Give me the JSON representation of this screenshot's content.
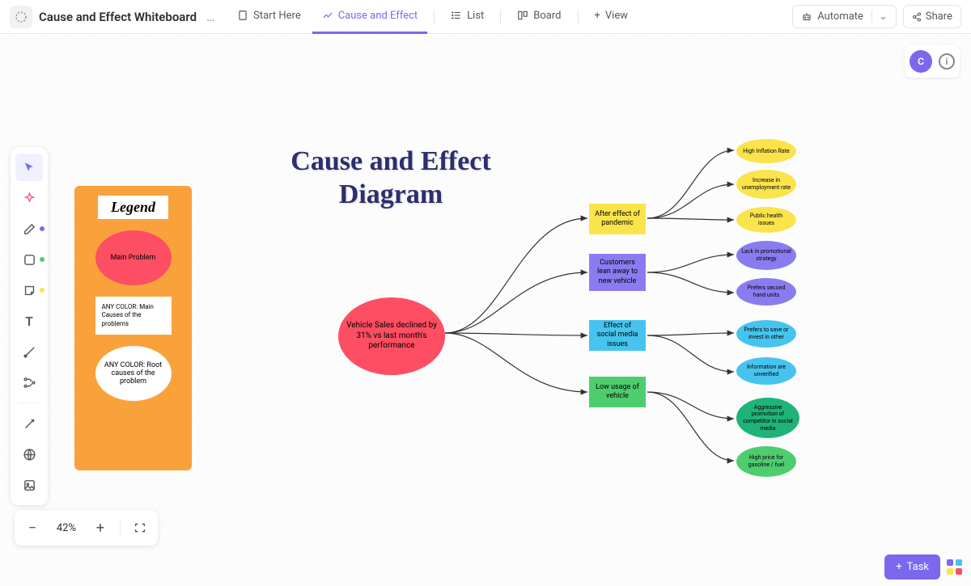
{
  "header": {
    "title": "Cause and Effect Whiteboard",
    "tabs": {
      "start": "Start Here",
      "cause": "Cause and Effect",
      "list": "List",
      "board": "Board",
      "view": "View"
    },
    "automate": "Automate",
    "share": "Share",
    "avatar": "C"
  },
  "zoom": {
    "value": "42%"
  },
  "task_btn": "Task",
  "diagram": {
    "title": "Cause and Effect Diagram",
    "legend": {
      "title": "Legend",
      "main_problem": "Main Problem",
      "main_causes": "ANY COLOR: Main Causes of the problems",
      "root_causes": "ANY COLOR: Root causes of the problem"
    },
    "problem": "Vehicle Sales declined by 31% vs last month's performance",
    "causes": {
      "c1": "After effect of pandemic",
      "c2": "Customers lean away to new vehicle",
      "c3": "Effect of social media issues",
      "c4": "Low usage of vehicle"
    },
    "roots": {
      "r1": "High Inflation Rate",
      "r2": "Increase in unemployment rate",
      "r3": "Public health issues",
      "r4": "Lack in promotional strategy",
      "r5": "Prefers second hand units",
      "r6": "Prefers to save or invest in other",
      "r7": "Information are unverified",
      "r8": "Aggressive promotion of competitor in social media",
      "r9": "High price for gasoline / fuel"
    }
  },
  "colors": {
    "red": "#fd4e63",
    "yellow": "#fbe44b",
    "purple": "#8a7cf0",
    "blue": "#46c4ef",
    "green": "#4ecd6f",
    "darkgreen": "#1fb37a"
  }
}
